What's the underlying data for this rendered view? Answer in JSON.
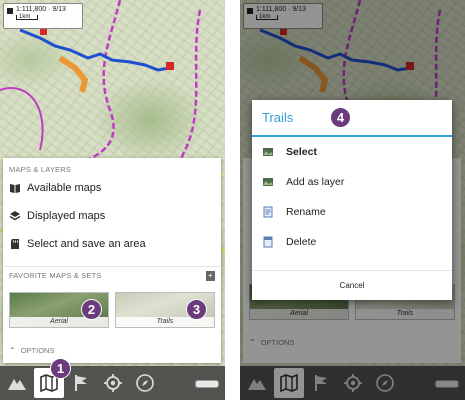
{
  "left": {
    "scale_text": "1:111,800 · 9/13",
    "scale_unit": "1km",
    "panel": {
      "maps_layers_label": "MAPS & LAYERS",
      "items": [
        {
          "label": "Available maps",
          "icon": "book-icon"
        },
        {
          "label": "Displayed maps",
          "icon": "layers-icon"
        },
        {
          "label": "Select and save an area",
          "icon": "sd-card-icon"
        }
      ],
      "favorites_label": "FAVORITE MAPS & SETS",
      "thumbs": [
        {
          "caption": "Aerial"
        },
        {
          "caption": "Trails"
        }
      ],
      "options_label": "OPTIONS"
    },
    "badges": [
      "1",
      "2",
      "3"
    ]
  },
  "right": {
    "scale_text": "1:111,800 · 9/13",
    "scale_unit": "1km",
    "under": {
      "thumbs": [
        {
          "caption": "Aerial"
        },
        {
          "caption": "Trails"
        }
      ],
      "options_label": "OPTIONS"
    },
    "dialog": {
      "title": "Trails",
      "badge": "4",
      "items": [
        {
          "label": "Select",
          "icon": "select-map-icon",
          "bold": true
        },
        {
          "label": "Add as layer",
          "icon": "add-layer-icon",
          "bold": false
        },
        {
          "label": "Rename",
          "icon": "rename-icon",
          "bold": false
        },
        {
          "label": "Delete",
          "icon": "delete-icon",
          "bold": false
        }
      ],
      "cancel_label": "Cancel"
    }
  },
  "toolbar": {
    "tools": [
      "mountain-icon",
      "map-icon",
      "flag-icon",
      "gps-target-icon",
      "compass-icon"
    ]
  },
  "colors": {
    "accent": "#33a0d8",
    "badge": "#6b3c7d",
    "track": "#1f4fd1",
    "boundary": "#c23ac7"
  }
}
